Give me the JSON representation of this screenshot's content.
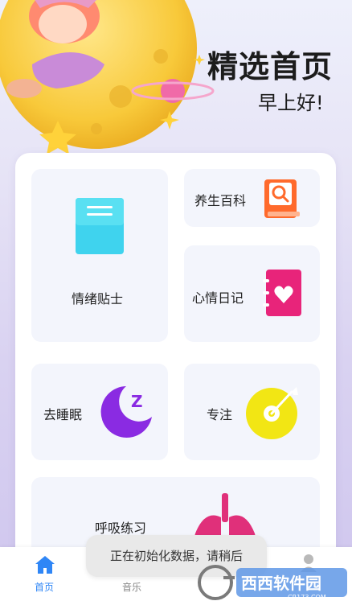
{
  "header": {
    "title": "精选首页",
    "greeting": "早上好!"
  },
  "cards": {
    "emotion_tips": {
      "label": "情绪贴士",
      "icon": "note-icon",
      "color": "#3fd3ee"
    },
    "health_wiki": {
      "label": "养生百科",
      "icon": "book-search-icon",
      "color": "#ff6a2c"
    },
    "mood_diary": {
      "label": "心情日记",
      "icon": "heart-notebook-icon",
      "color": "#e8247a"
    },
    "go_sleep": {
      "label": "去睡眠",
      "icon": "moon-icon",
      "color": "#8a2be2"
    },
    "focus": {
      "label": "专注",
      "icon": "target-icon",
      "color": "#f2e614"
    },
    "breathing": {
      "label": "呼吸练习",
      "icon": "lungs-icon",
      "color": "#e0307a"
    }
  },
  "bottom_nav": {
    "items": [
      {
        "label": "首页",
        "icon": "home-icon",
        "active": true
      },
      {
        "label": "音乐",
        "icon": "music-icon",
        "active": false
      },
      {
        "label": "",
        "icon": "profile-icon",
        "active": false
      }
    ]
  },
  "toast": {
    "text": "正在初始化数据，请稍后"
  },
  "watermark": {
    "brand": "西西软件园",
    "domain": "CR173.COM"
  },
  "colors": {
    "accent": "#2f86f6",
    "card_bg": "#f3f5fc"
  }
}
